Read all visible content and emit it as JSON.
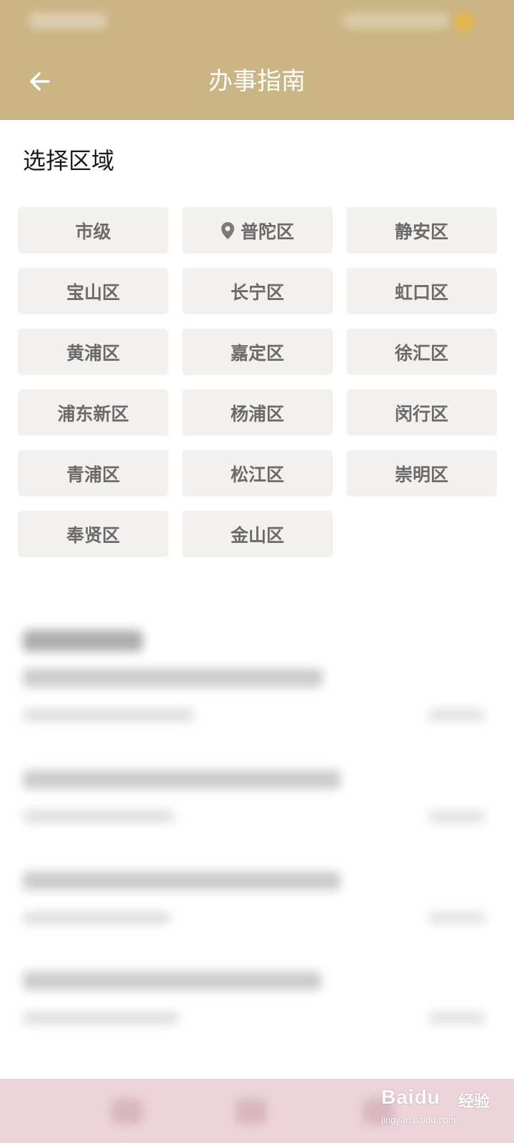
{
  "header": {
    "title": "办事指南",
    "background_color": "#cbb585",
    "back_icon": "arrow-left-icon"
  },
  "region_section": {
    "title": "选择区域",
    "regions": [
      {
        "label": "市级",
        "icon": ""
      },
      {
        "label": "普陀区",
        "icon": "location-pin-icon"
      },
      {
        "label": "静安区",
        "icon": ""
      },
      {
        "label": "宝山区",
        "icon": ""
      },
      {
        "label": "长宁区",
        "icon": ""
      },
      {
        "label": "虹口区",
        "icon": ""
      },
      {
        "label": "黄浦区",
        "icon": ""
      },
      {
        "label": "嘉定区",
        "icon": ""
      },
      {
        "label": "徐汇区",
        "icon": ""
      },
      {
        "label": "浦东新区",
        "icon": ""
      },
      {
        "label": "杨浦区",
        "icon": ""
      },
      {
        "label": "闵行区",
        "icon": ""
      },
      {
        "label": "青浦区",
        "icon": ""
      },
      {
        "label": "松江区",
        "icon": ""
      },
      {
        "label": "崇明区",
        "icon": ""
      },
      {
        "label": "奉贤区",
        "icon": ""
      },
      {
        "label": "金山区",
        "icon": ""
      }
    ]
  },
  "bottom_nav": {
    "background_color": "#ecd4da"
  },
  "watermark": {
    "brand": "Baidu",
    "cn": "经验",
    "url": "jingyan.baidu.com"
  }
}
